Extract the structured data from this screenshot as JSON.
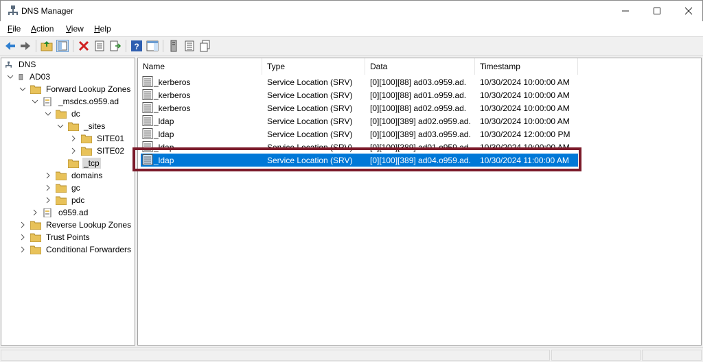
{
  "window": {
    "title": "DNS Manager",
    "icon": "dns-manager-icon",
    "controls": [
      "minimize-icon",
      "maximize-icon",
      "close-icon"
    ]
  },
  "menu": [
    {
      "label": "File",
      "access": "F",
      "rest": "ile"
    },
    {
      "label": "Action",
      "access": "A",
      "rest": "ction"
    },
    {
      "label": "View",
      "access": "V",
      "rest": "iew"
    },
    {
      "label": "Help",
      "access": "H",
      "rest": "elp"
    }
  ],
  "toolbar": [
    "back-icon",
    "forward-icon",
    "up-folder-icon",
    "show-hide-console-tree-icon",
    "delete-icon",
    "properties-icon",
    "export-list-icon",
    "help-icon",
    "show-action-pane-icon",
    "server-icon",
    "list-icon",
    "copy-icon"
  ],
  "tree": {
    "root": "DNS",
    "server": "AD03",
    "forward_zones": "Forward Lookup Zones",
    "msdcs_zone": "_msdcs.o959.ad",
    "dc": "dc",
    "sites": "_sites",
    "site01": "SITE01",
    "site02": "SITE02",
    "tcp": "_tcp",
    "domains": "domains",
    "gc": "gc",
    "pdc": "pdc",
    "o959_zone": "o959.ad",
    "reverse_zones": "Reverse Lookup Zones",
    "trust_points": "Trust Points",
    "conditional_forwarders": "Conditional Forwarders"
  },
  "list": {
    "columns": {
      "name": "Name",
      "type": "Type",
      "data": "Data",
      "timestamp": "Timestamp"
    },
    "rows": [
      {
        "name": "_kerberos",
        "type": "Service Location (SRV)",
        "data": "[0][100][88] ad03.o959.ad.",
        "timestamp": "10/30/2024 10:00:00 AM"
      },
      {
        "name": "_kerberos",
        "type": "Service Location (SRV)",
        "data": "[0][100][88] ad01.o959.ad.",
        "timestamp": "10/30/2024 10:00:00 AM"
      },
      {
        "name": "_kerberos",
        "type": "Service Location (SRV)",
        "data": "[0][100][88] ad02.o959.ad.",
        "timestamp": "10/30/2024 10:00:00 AM"
      },
      {
        "name": "_ldap",
        "type": "Service Location (SRV)",
        "data": "[0][100][389] ad02.o959.ad.",
        "timestamp": "10/30/2024 10:00:00 AM"
      },
      {
        "name": "_ldap",
        "type": "Service Location (SRV)",
        "data": "[0][100][389] ad03.o959.ad.",
        "timestamp": "10/30/2024 12:00:00 PM"
      },
      {
        "name": "_ldap",
        "type": "Service Location (SRV)",
        "data": "[0][100][389] ad01.o959.ad.",
        "timestamp": "10/30/2024 10:00:00 AM"
      },
      {
        "name": "_ldap",
        "type": "Service Location (SRV)",
        "data": "[0][100][389] ad04.o959.ad.",
        "timestamp": "10/30/2024 11:00:00 AM"
      }
    ],
    "selected_row": "_ldap"
  },
  "colors": {
    "selection": "#0078d7",
    "highlight_border": "#7b1a2a",
    "folder": "#e8c25a"
  }
}
